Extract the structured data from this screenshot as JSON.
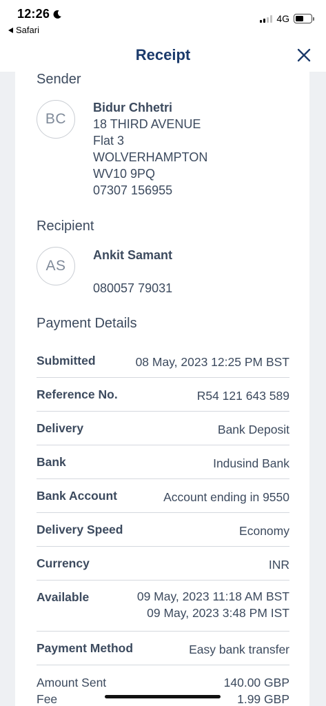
{
  "status_bar": {
    "time": "12:26",
    "back_app": "Safari",
    "network": "4G"
  },
  "nav": {
    "title": "Receipt"
  },
  "sender": {
    "section_title": "Sender",
    "initials": "BC",
    "name": "Bidur Chhetri",
    "address_lines": [
      "18 THIRD AVENUE",
      "Flat 3",
      "WOLVERHAMPTON",
      "WV10 9PQ"
    ],
    "phone": "07307 156955"
  },
  "recipient": {
    "section_title": "Recipient",
    "initials": "AS",
    "name": "Ankit Samant",
    "phone": "080057 79031"
  },
  "payment": {
    "section_title": "Payment Details",
    "rows": [
      {
        "label": "Submitted",
        "value": "08 May, 2023 12:25 PM BST"
      },
      {
        "label": "Reference No.",
        "value": "R54 121 643 589"
      },
      {
        "label": "Delivery",
        "value": "Bank Deposit"
      },
      {
        "label": "Bank",
        "value": "Indusind Bank"
      },
      {
        "label": "Bank Account",
        "value": "Account ending in 9550"
      },
      {
        "label": "Delivery Speed",
        "value": "Economy"
      },
      {
        "label": "Currency",
        "value": "INR"
      },
      {
        "label": "Available",
        "value": "09 May, 2023 11:18 AM BST",
        "value2": "09 May, 2023 3:48 PM IST"
      },
      {
        "label": "Payment Method",
        "value": "Easy bank transfer"
      }
    ],
    "amounts": [
      {
        "label": "Amount Sent",
        "value": "140.00 GBP"
      },
      {
        "label": "Fee",
        "value": "1.99 GBP"
      }
    ]
  }
}
